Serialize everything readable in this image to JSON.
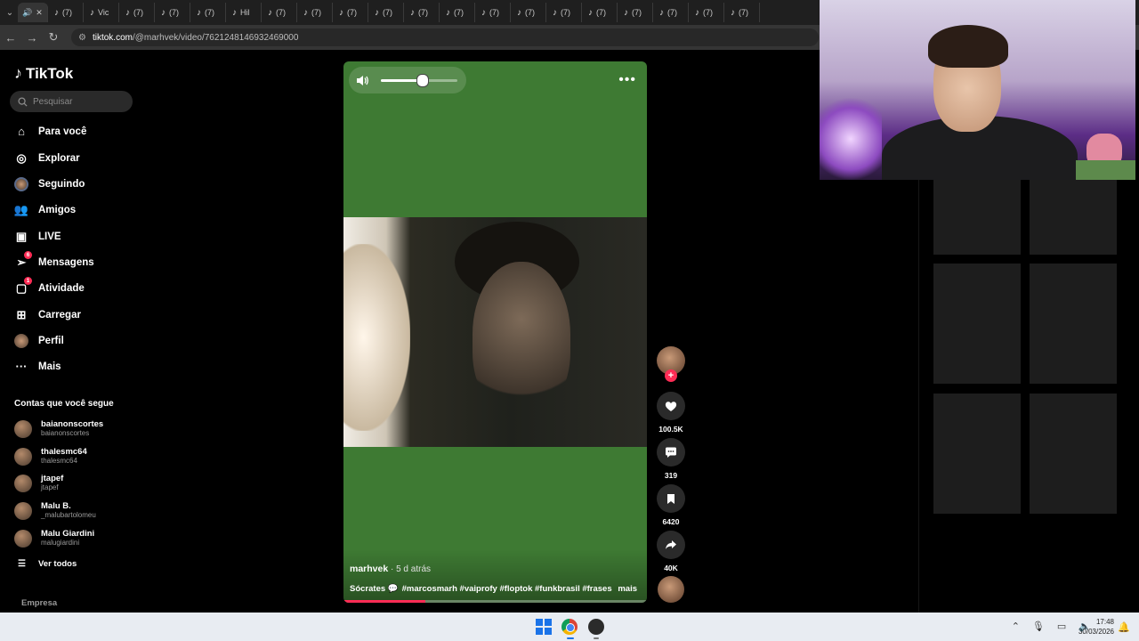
{
  "browser": {
    "tabs": [
      {
        "label": "(7)"
      },
      {
        "label": "Vic"
      },
      {
        "label": "(7)"
      },
      {
        "label": "(7)"
      },
      {
        "label": "(7)"
      },
      {
        "label": "Hil"
      },
      {
        "label": "(7)"
      },
      {
        "label": "(7)"
      },
      {
        "label": "(7)"
      },
      {
        "label": "(7)"
      },
      {
        "label": "(7)"
      },
      {
        "label": "(7)"
      },
      {
        "label": "(7)"
      },
      {
        "label": "(7)"
      },
      {
        "label": "(7)"
      },
      {
        "label": "(7)"
      },
      {
        "label": "(7)"
      },
      {
        "label": "(7)"
      },
      {
        "label": "(7)"
      },
      {
        "label": "(7)"
      }
    ],
    "url_host": "tiktok.com",
    "url_path": "/@marhvek/video/7621248146932469000"
  },
  "sidebar": {
    "logo": "TikTok",
    "search_placeholder": "Pesquisar",
    "nav": [
      {
        "label": "Para você",
        "icon": "home-icon"
      },
      {
        "label": "Explorar",
        "icon": "compass-icon"
      },
      {
        "label": "Seguindo",
        "icon": "following-avatar-icon"
      },
      {
        "label": "Amigos",
        "icon": "friends-icon"
      },
      {
        "label": "LIVE",
        "icon": "live-tv-icon"
      },
      {
        "label": "Mensagens",
        "icon": "send-icon",
        "badge": "6"
      },
      {
        "label": "Atividade",
        "icon": "activity-icon",
        "badge": "1"
      },
      {
        "label": "Carregar",
        "icon": "upload-icon"
      },
      {
        "label": "Perfil",
        "icon": "profile-avatar-icon"
      },
      {
        "label": "Mais",
        "icon": "more-dots-icon"
      }
    ],
    "following_title": "Contas que você segue",
    "following": [
      {
        "name": "baianonscortes",
        "handle": "baianonscortes"
      },
      {
        "name": "thalesmc64",
        "handle": "thalesmc64"
      },
      {
        "name": "jtapef",
        "handle": "jtapef"
      },
      {
        "name": "Malu B.",
        "handle": "_malubartolomeu"
      },
      {
        "name": "Malu Giardini",
        "handle": "malugiardini"
      }
    ],
    "see_all": "Ver todos",
    "company": "Empresa"
  },
  "video": {
    "author": "marhvek",
    "time": " · 5 d atrás",
    "caption_prefix": "Sócrates 💬",
    "hashtags": "#marcosmarh #vaiprofy #floptok #funkbrasil #frases",
    "more_label": "mais",
    "volume_level": 0.55,
    "progress": 0.27
  },
  "actions": {
    "likes": "100.5K",
    "comments": "319",
    "saves": "6420",
    "shares": "40K"
  },
  "taskbar": {
    "time": "17:48",
    "date": "30/03/2026"
  },
  "colors": {
    "accent": "#fe2c55",
    "video_bg": "#3e7a33"
  }
}
